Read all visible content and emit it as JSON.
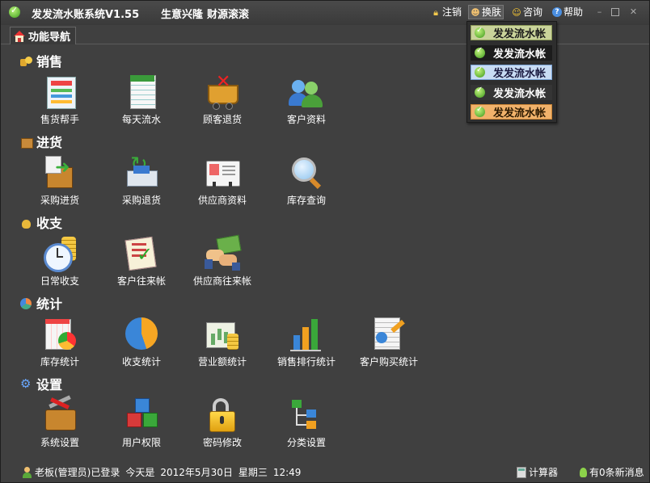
{
  "window": {
    "title": "发发流水账系统V1.55",
    "slogan_1": "生意兴隆",
    "slogan_2": "财源滚滚",
    "buttons": {
      "logout": "注销",
      "swap_skin": "换肤",
      "consult": "咨询",
      "help": "帮助"
    }
  },
  "tabs": [
    {
      "label": "功能导航"
    }
  ],
  "skin_menu": {
    "items": [
      {
        "label": "发发流水帐",
        "bg": "#c9d39a",
        "border": "#8c9a58",
        "text": "#1a1a1a"
      },
      {
        "label": "发发流水帐",
        "bg": "#1c1c1c",
        "border": "#1c1c1c",
        "text": "#ffffff"
      },
      {
        "label": "发发流水帐",
        "bg": "#c8dcf4",
        "border": "#7aa3d4",
        "text": "#1a1a40"
      },
      {
        "label": "发发流水帐",
        "bg": "#353535",
        "border": "#353535",
        "text": "#ffffff"
      },
      {
        "label": "发发流水帐",
        "bg": "#f1b26b",
        "border": "#c98436",
        "text": "#2a1800"
      }
    ]
  },
  "sections": [
    {
      "title": "销售",
      "icon": "coins-icon",
      "items": [
        {
          "label": "售货帮手",
          "icon": "sales-helper-icon"
        },
        {
          "label": "每天流水",
          "icon": "daily-ledger-icon"
        },
        {
          "label": "顾客退货",
          "icon": "customer-return-cart-icon"
        },
        {
          "label": "客户资料",
          "icon": "customer-info-icon"
        }
      ]
    },
    {
      "title": "进货",
      "icon": "purchase-box-icon",
      "items": [
        {
          "label": "采购进货",
          "icon": "purchase-in-icon"
        },
        {
          "label": "采购退货",
          "icon": "purchase-return-icon"
        },
        {
          "label": "供应商资料",
          "icon": "supplier-card-icon"
        },
        {
          "label": "库存查询",
          "icon": "magnifier-icon"
        }
      ]
    },
    {
      "title": "收支",
      "icon": "money-bag-icon",
      "items": [
        {
          "label": "日常收支",
          "icon": "clock-coins-icon"
        },
        {
          "label": "客户往来帐",
          "icon": "checklist-icon"
        },
        {
          "label": "供应商往来帐",
          "icon": "handshake-money-icon"
        }
      ]
    },
    {
      "title": "统计",
      "icon": "stats-icon",
      "items": [
        {
          "label": "库存统计",
          "icon": "inventory-report-icon"
        },
        {
          "label": "收支统计",
          "icon": "pie-chart-icon"
        },
        {
          "label": "营业额统计",
          "icon": "revenue-chart-icon"
        },
        {
          "label": "销售排行统计",
          "icon": "bar-ranking-icon"
        },
        {
          "label": "客户购买统计",
          "icon": "customer-purchase-report-icon"
        }
      ]
    },
    {
      "title": "设置",
      "icon": "gear-icon",
      "items": [
        {
          "label": "系统设置",
          "icon": "toolbox-icon"
        },
        {
          "label": "用户权限",
          "icon": "cubes-icon"
        },
        {
          "label": "密码修改",
          "icon": "padlock-icon"
        },
        {
          "label": "分类设置",
          "icon": "tree-icon"
        }
      ]
    }
  ],
  "status": {
    "user": "老板(管理员)已登录",
    "today_label": "今天是",
    "date": "2012年5月30日",
    "weekday": "星期三",
    "time": "12:49",
    "calculator": "计算器",
    "messages": "有0条新消息"
  }
}
